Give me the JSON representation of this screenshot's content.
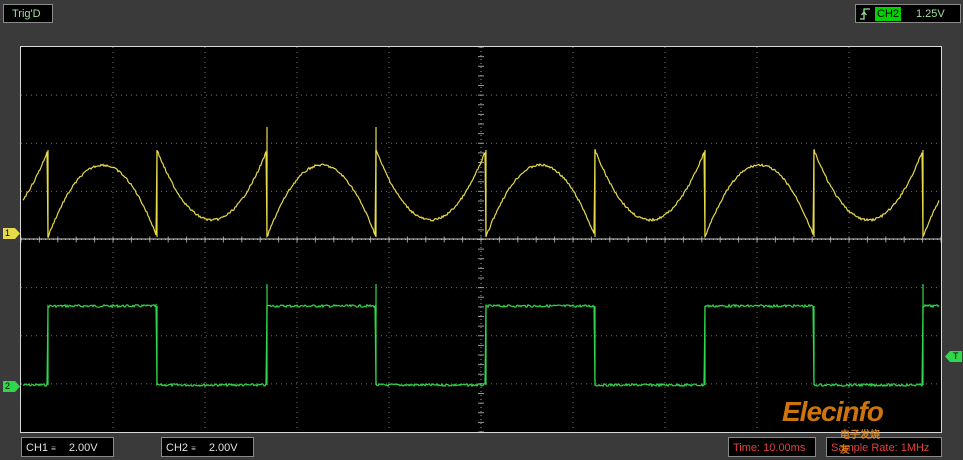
{
  "top": {
    "trigger_status": "Trig'D",
    "trigger_source": "CH2",
    "trigger_level": "1.25V",
    "trigger_edge_icon": "rising-edge-icon"
  },
  "markers": {
    "ch1": "1",
    "ch2": "2",
    "trigger": "T"
  },
  "bottom": {
    "ch1_label": "CH1",
    "ch1_scale": "2.00V",
    "ch2_label": "CH2",
    "ch2_scale": "2.00V",
    "timebase": "Time: 10.00ms",
    "sample_rate": "Sample Rate: 1MHz"
  },
  "watermark": {
    "logo": "Elecinfo",
    "sub": "电子发烧友"
  },
  "colors": {
    "ch1": "#e6d94a",
    "ch2": "#2fd84a",
    "grid": "#6e6e6e",
    "screen_bg": "#000000",
    "status_red": "#e04040"
  }
}
